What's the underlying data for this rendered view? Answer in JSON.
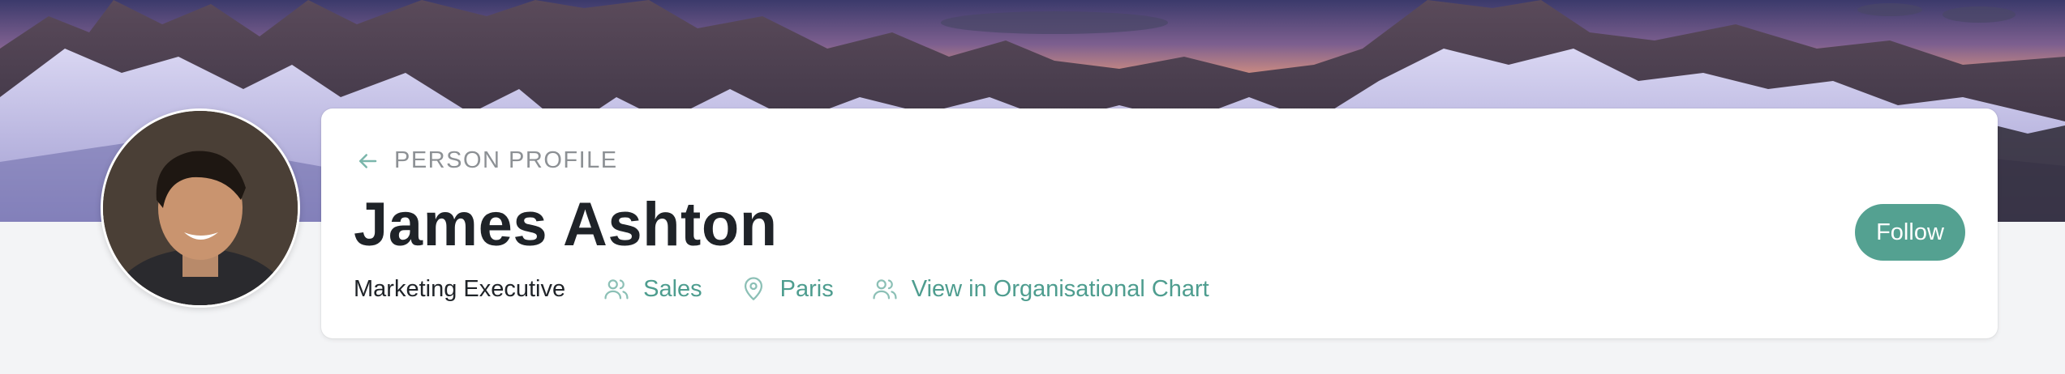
{
  "profile": {
    "eyebrow": "PERSON PROFILE",
    "name": "James Ashton",
    "job_title": "Marketing Executive",
    "department": "Sales",
    "location": "Paris",
    "org_chart_link": "View in Organisational Chart",
    "follow_label": "Follow"
  },
  "icons": {
    "back": "arrow-left-icon",
    "department": "users-icon",
    "location": "map-pin-icon",
    "org_chart": "users-icon"
  },
  "colors": {
    "accent": "#4e9d8f",
    "button": "#54a191",
    "text_primary": "#1f2328",
    "text_muted": "#8d9195",
    "page_background": "#f3f4f6"
  }
}
